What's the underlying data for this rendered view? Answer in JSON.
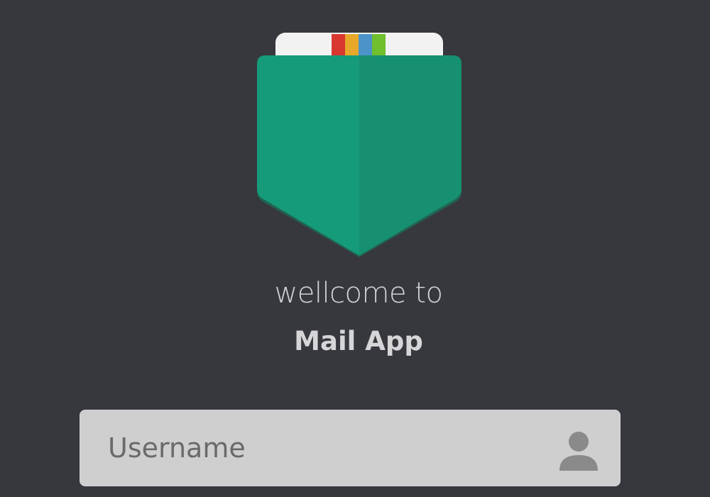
{
  "logo": {
    "icon": "mail-pocket-icon",
    "colors": {
      "pocket_left": "#169b7a",
      "pocket_right": "#178f71",
      "card": "#f2f2f2",
      "stripe_red": "#d8382f",
      "stripe_yellow": "#e8a82a",
      "stripe_blue": "#4b93c9",
      "stripe_green": "#6fbf2e"
    }
  },
  "welcome": {
    "line1": "wellcome to",
    "line2": "Mail App"
  },
  "login": {
    "username_placeholder": "Username",
    "username_value": "",
    "username_icon": "user-icon"
  },
  "colors": {
    "background": "#37383d",
    "field_background": "#cfcfcf",
    "text": "#d2d2d4"
  }
}
